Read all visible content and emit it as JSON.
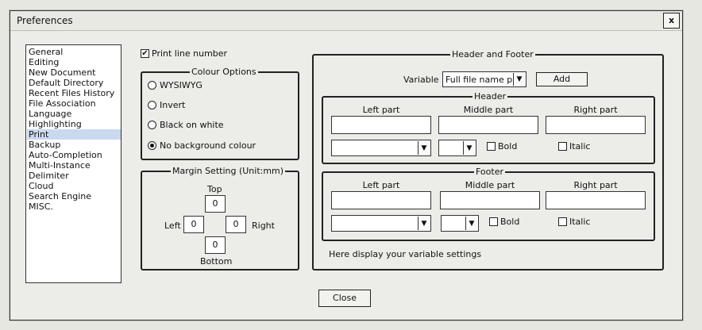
{
  "window": {
    "title": "Preferences",
    "close_glyph": "x"
  },
  "categories": {
    "items": [
      "General",
      "Editing",
      "New Document",
      "Default Directory",
      "Recent Files History",
      "File Association",
      "Language",
      "Highlighting",
      "Print",
      "Backup",
      "Auto-Completion",
      "Multi-Instance",
      "Delimiter",
      "Cloud",
      "Search Engine",
      "MISC."
    ],
    "selected_index": 8
  },
  "print": {
    "line_number_label": "Print line number",
    "line_number_checked": true
  },
  "colour_options": {
    "title": "Colour Options",
    "options": [
      "WYSIWYG",
      "Invert",
      "Black on white",
      "No background colour"
    ],
    "selected_index": 3
  },
  "margin": {
    "title": "Margin Setting (Unit:mm)",
    "top_label": "Top",
    "left_label": "Left",
    "right_label": "Right",
    "bottom_label": "Bottom",
    "top": "0",
    "left": "0",
    "right": "0",
    "bottom": "0"
  },
  "header_footer": {
    "title": "Header and Footer",
    "variable_label": "Variable :",
    "variable_value": "Full file name pat",
    "add_label": "Add",
    "header": {
      "title": "Header",
      "left_label": "Left part",
      "middle_label": "Middle part",
      "right_label": "Right part",
      "bold_label": "Bold",
      "italic_label": "Italic"
    },
    "footer": {
      "title": "Footer",
      "left_label": "Left part",
      "middle_label": "Middle part",
      "right_label": "Right part",
      "bold_label": "Bold",
      "italic_label": "Italic"
    },
    "info": "Here display your variable settings"
  },
  "buttons": {
    "close_label": "Close"
  }
}
